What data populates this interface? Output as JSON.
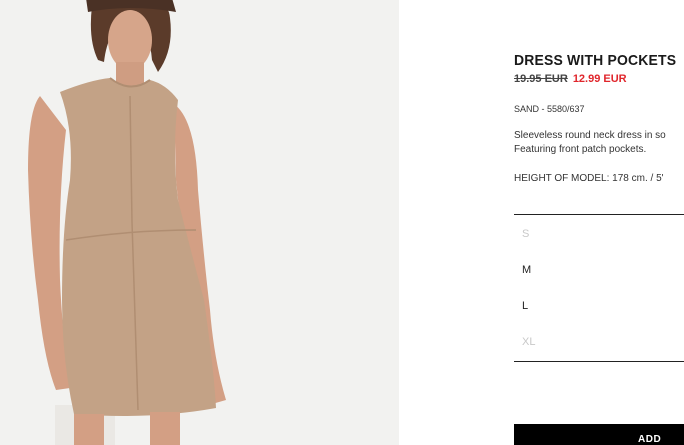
{
  "product": {
    "title": "DRESS WITH POCKETS",
    "old_price": "19.95 EUR",
    "new_price": "12.99 EUR",
    "reference": "SAND - 5580/637",
    "description_line1": "Sleeveless round neck dress in so",
    "description_line2": "Featuring front patch pockets.",
    "model_height": "HEIGHT OF MODEL: 178 cm. / 5'"
  },
  "sizes": [
    {
      "label": "S",
      "available": false
    },
    {
      "label": "M",
      "available": true
    },
    {
      "label": "L",
      "available": true
    },
    {
      "label": "XL",
      "available": false
    }
  ],
  "actions": {
    "add_label": "ADD"
  },
  "colors": {
    "sale_price": "#e0262c",
    "button_bg": "#000000",
    "dress": "#c3a286"
  },
  "image": {
    "subject": "model-wearing-sand-suede-dress"
  }
}
